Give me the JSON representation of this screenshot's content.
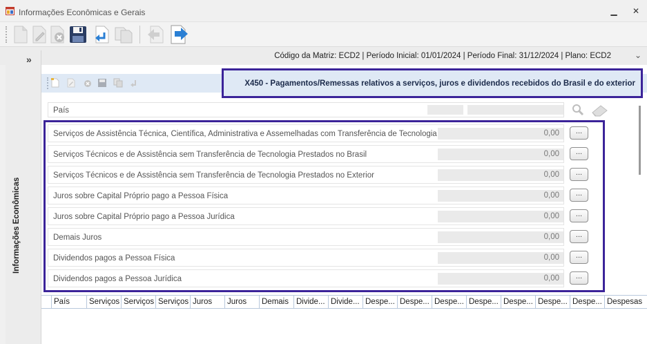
{
  "window": {
    "title": "Informações Econômicas e Gerais",
    "minimize_symbol": "▁",
    "close_symbol": "✕"
  },
  "toolbar": {
    "buttons": [
      "new-icon",
      "edit-icon",
      "delete-icon",
      "save-icon",
      "undo-icon",
      "copy-icon",
      "back-icon",
      "forward-icon"
    ]
  },
  "info_bar": {
    "text": "Código da Matriz: ECD2 | Período Inicial: 01/01/2024 | Período Final: 31/12/2024 | Plano: ECD2",
    "chevron": "⌄"
  },
  "left_panel": {
    "collapse_symbol": "»",
    "label": "Informações Econômicas"
  },
  "section": {
    "title": "X450 - Pagamentos/Remessas relativos a serviços, juros e dividendos recebidos do Brasil e do exterior"
  },
  "pais_field": {
    "label": "País"
  },
  "rows": [
    {
      "label": "Serviços de Assistência Técnica, Científica, Administrativa e Assemelhadas com Transferência de Tecnologia",
      "value": "0,00",
      "button": "..."
    },
    {
      "label": "Serviços Técnicos e de Assistência sem Transferência de Tecnologia Prestados no Brasil",
      "value": "0,00",
      "button": "..."
    },
    {
      "label": "Serviços Técnicos e de Assistência sem Transferência de Tecnologia Prestados no Exterior",
      "value": "0,00",
      "button": "..."
    },
    {
      "label": "Juros sobre Capital Próprio pago a Pessoa Física",
      "value": "0,00",
      "button": "..."
    },
    {
      "label": "Juros sobre Capital Próprio pago a Pessoa Jurídica",
      "value": "0,00",
      "button": "..."
    },
    {
      "label": "Demais Juros",
      "value": "0,00",
      "button": "..."
    },
    {
      "label": "Dividendos pagos a Pessoa Física",
      "value": "0,00",
      "button": "..."
    },
    {
      "label": "Dividendos pagos a Pessoa Jurídica",
      "value": "0,00",
      "button": "..."
    }
  ],
  "grid": {
    "columns": [
      "País",
      "Serviços",
      "Serviços",
      "Serviços",
      "Juros",
      "Juros",
      "Demais",
      "Divide...",
      "Divide...",
      "Despe...",
      "Despe...",
      "Despe...",
      "Despe...",
      "Despe...",
      "Despe...",
      "Despe...",
      "Despesas"
    ]
  },
  "colors": {
    "highlight_border": "#3b2399",
    "subtoolbar_bg": "#dfe9f5"
  }
}
